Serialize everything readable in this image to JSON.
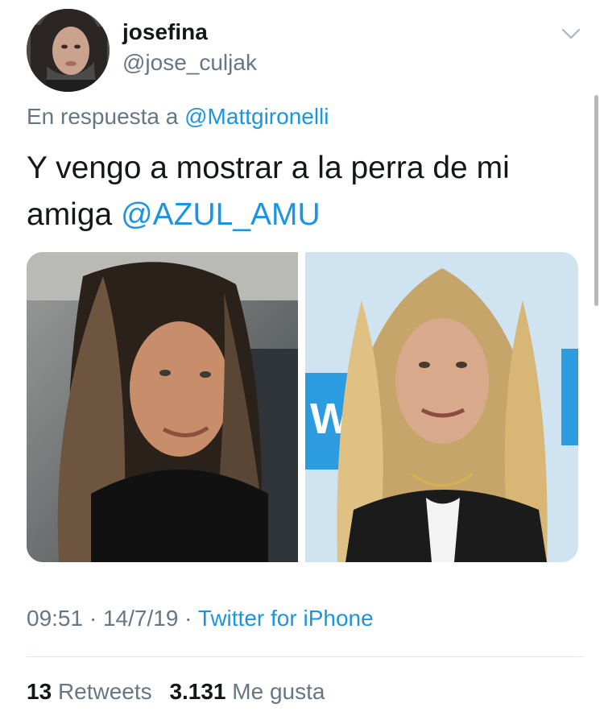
{
  "tweet": {
    "display_name": "josefina",
    "handle": "@jose_culjak",
    "reply_prefix": "En respuesta a",
    "reply_to": "@Mattgironelli",
    "text_main": "Y vengo a mostrar a la perra de mi amiga",
    "text_mention": "@AZUL_AMU",
    "time": "09:51",
    "date": "14/7/19",
    "source": "Twitter for iPhone",
    "retweets_count": "13",
    "retweets_label": "Retweets",
    "likes_count": "3.131",
    "likes_label": "Me gusta"
  },
  "icons": {
    "menu": "chevron-down-icon"
  },
  "colors": {
    "link": "#1b95e0",
    "secondary_text": "#657786",
    "primary_text": "#14171a",
    "divider": "#e1e8ed"
  }
}
